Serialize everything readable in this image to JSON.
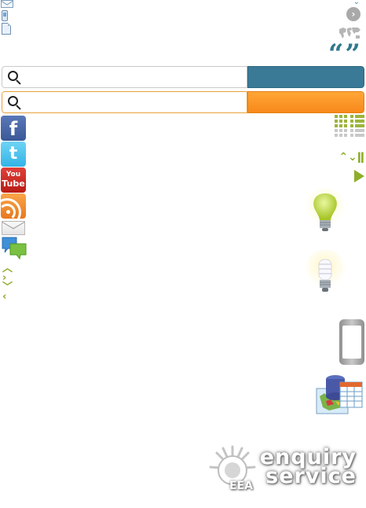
{
  "icons": {
    "mail_small": "mail-icon",
    "phone_small": "phone-icon",
    "document_small": "document-icon",
    "circle_arrow_glyph": "›",
    "quotes_glyph": "“”",
    "facebook_glyph": "f",
    "twitter_glyph": "t",
    "youtube_top": "You",
    "youtube_bottom": "Tube",
    "arrows_glyph": "⌃⌄ǁ",
    "chevrons": [
      "^",
      ">",
      "v",
      "<"
    ]
  },
  "search": {
    "primary_placeholder": "",
    "secondary_placeholder": ""
  },
  "logo": {
    "line1": "enquiry",
    "line2": "service",
    "org": "EEA"
  },
  "colors": {
    "accent_blue": "#3a7a96",
    "accent_orange": "#f7891a",
    "accent_green": "#8fae2a",
    "quote_blue": "#31788e"
  }
}
